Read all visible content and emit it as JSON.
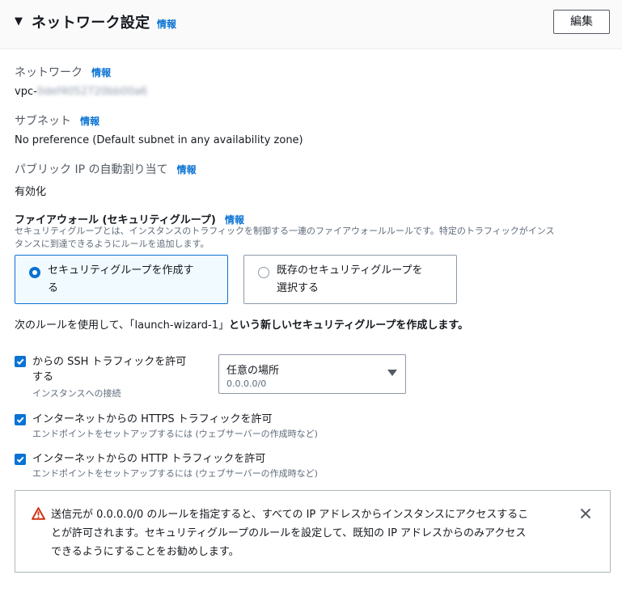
{
  "header": {
    "title": "ネットワーク設定",
    "info_label": "情報",
    "edit_label": "編集"
  },
  "network": {
    "label": "ネットワーク",
    "info": "情報",
    "value_prefix": "vpc-",
    "value_masked": "0def4052720bb00a6"
  },
  "subnet": {
    "label": "サブネット",
    "info": "情報",
    "value": "No preference (Default subnet in any availability zone)"
  },
  "public_ip": {
    "label": "パブリック IP の自動割り当て",
    "info": "情報",
    "value": "有効化"
  },
  "firewall": {
    "title": "ファイアウォール (セキュリティグループ)",
    "info": "情報",
    "desc_line1": "セキュリティグループとは、インスタンスのトラフィックを制御する一連のファイアウォールルールです。特定のトラフィックがインス",
    "desc_line2": "タンスに到達できるようにルールを追加します。",
    "options": [
      {
        "line1": "セキュリティグループを作成す",
        "line2": "る",
        "selected": true
      },
      {
        "line1": "既存のセキュリティグループを",
        "line2": "選択する",
        "selected": false
      }
    ],
    "rule_sentence_prefix": "次のルールを使用して、「launch-wizard-1」",
    "rule_sentence_bold": "という新しいセキュリティグループを作成します。"
  },
  "rules": {
    "ssh": {
      "label_line1": "からの SSH トラフィックを許可",
      "label_line2": "する",
      "sub": "インスタンスへの接続",
      "checked": true,
      "select_value": "任意の場所",
      "select_sub": "0.0.0.0/0"
    },
    "https": {
      "label": "インターネットからの HTTPS トラフィックを許可",
      "sub": "エンドポイントをセットアップするには (ウェブサーバーの作成時など)",
      "checked": true
    },
    "http": {
      "label": "インターネットからの HTTP トラフィックを許可",
      "sub": "エンドポイントをセットアップするには (ウェブサーバーの作成時など)",
      "checked": true
    }
  },
  "alert": {
    "line1": "送信元が 0.0.0.0/0 のルールを指定すると、すべての IP アドレスからインスタンスにアクセスするこ",
    "line2": "とが許可されます。セキュリティグループのルールを設定して、既知の IP アドレスからのみアクセス",
    "line3": "できるようにすることをお勧めします。",
    "icon": "warning-icon",
    "close_icon": "close-icon"
  },
  "colors": {
    "accent": "#0972d3",
    "warning": "#d13212",
    "border": "#8d99a8"
  }
}
